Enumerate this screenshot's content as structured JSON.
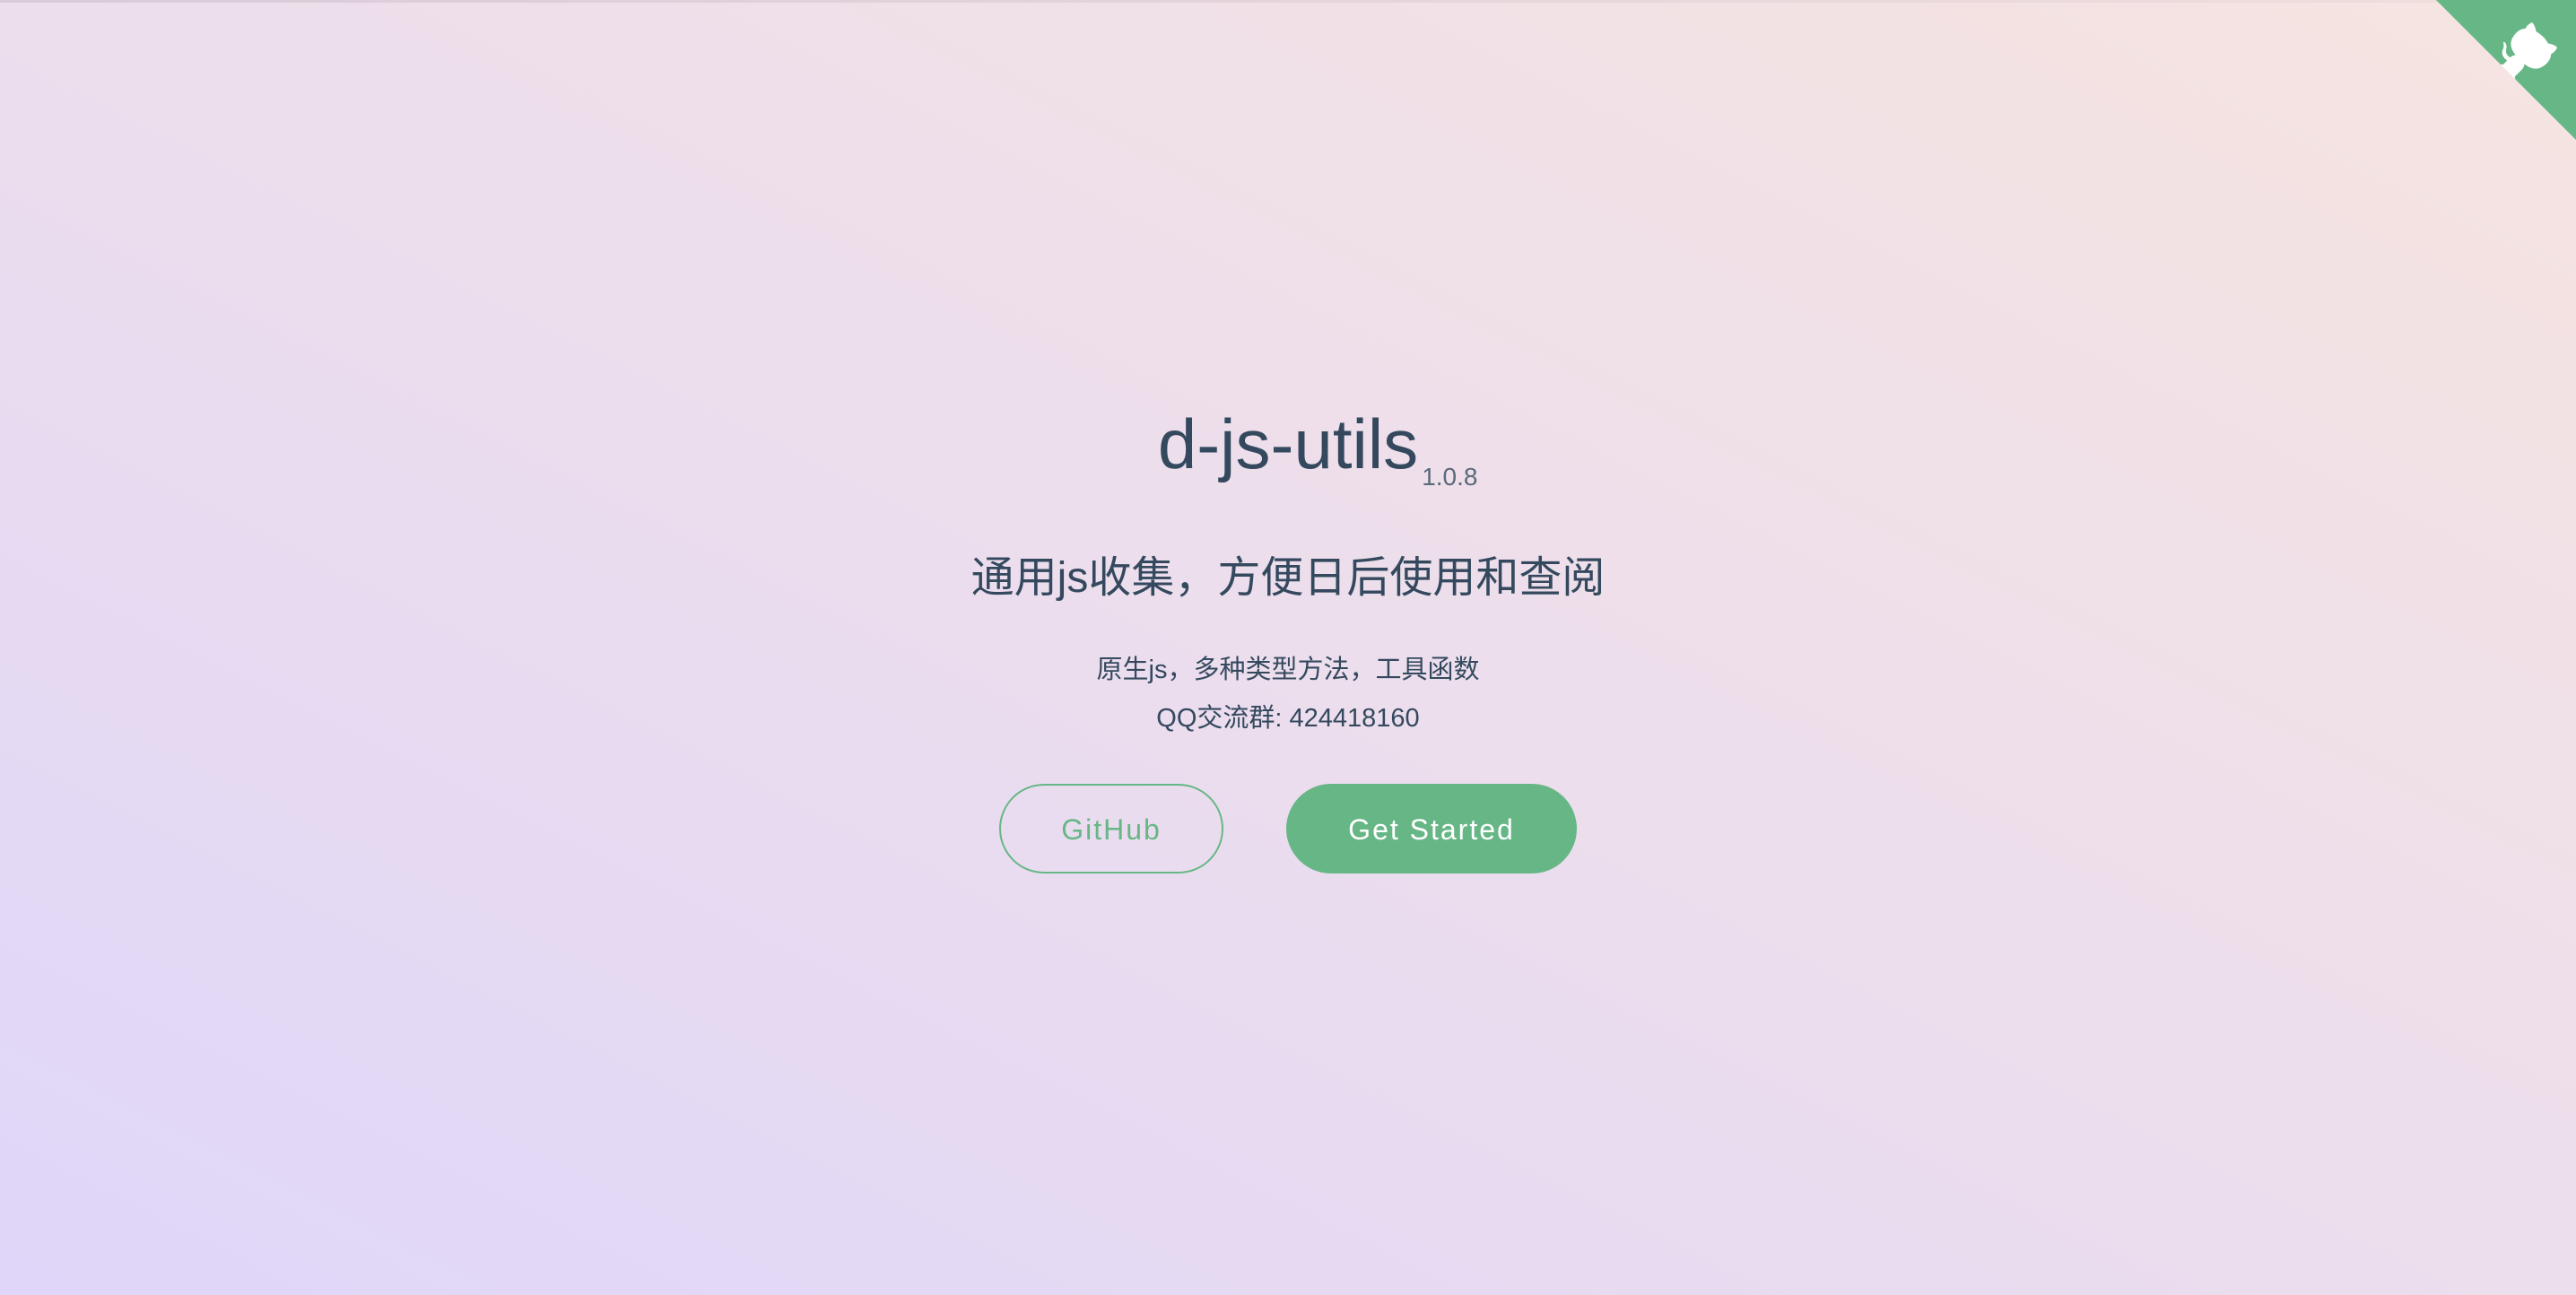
{
  "cover": {
    "title": "d-js-utils",
    "version": "1.0.8",
    "tagline": "通用js收集，方便日后使用和查阅",
    "description_1": "原生js，多种类型方法，工具函数",
    "description_2": "QQ交流群: 424418160"
  },
  "buttons": {
    "github_label": "GitHub",
    "start_label": "Get Started"
  },
  "corner": {
    "icon": "github-octocat-icon",
    "color": "#67b786"
  },
  "colors": {
    "accent": "#67b786",
    "text": "#34495e"
  }
}
